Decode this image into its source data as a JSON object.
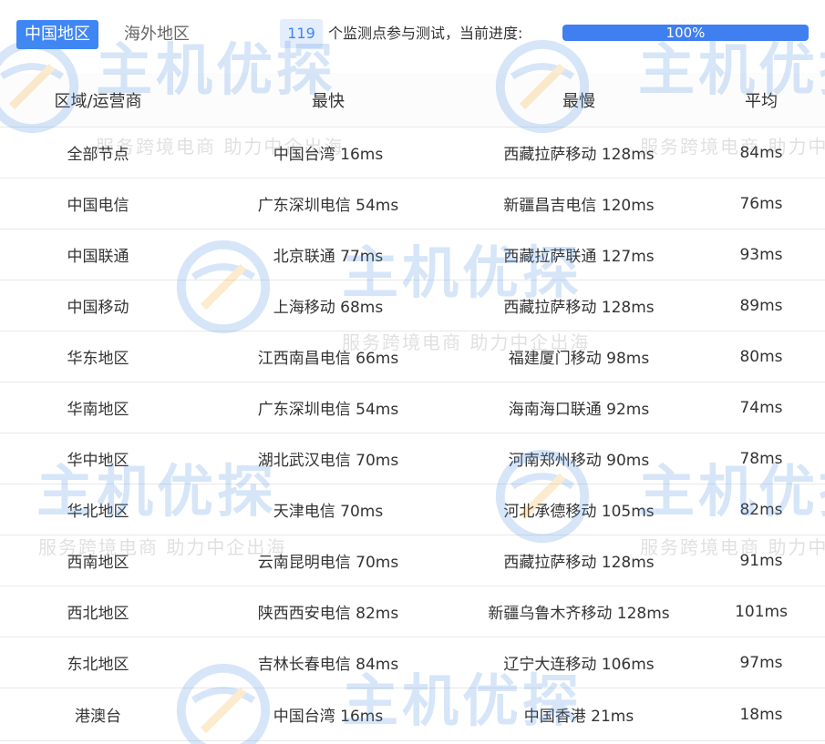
{
  "tabs": {
    "active_label": "中国地区",
    "inactive_label": "海外地区"
  },
  "monitor": {
    "count": "119",
    "text": "个监测点参与测试，当前进度:",
    "progress_percent": 100,
    "progress_label": "100%"
  },
  "table": {
    "headers": {
      "region": "区域/运营商",
      "fastest": "最快",
      "slowest": "最慢",
      "average": "平均"
    },
    "rows": [
      {
        "region": "全部节点",
        "fastest": "中国台湾 16ms",
        "slowest": "西藏拉萨移动 128ms",
        "average": "84ms"
      },
      {
        "region": "中国电信",
        "fastest": "广东深圳电信 54ms",
        "slowest": "新疆昌吉电信 120ms",
        "average": "76ms"
      },
      {
        "region": "中国联通",
        "fastest": "北京联通 77ms",
        "slowest": "西藏拉萨联通 127ms",
        "average": "93ms"
      },
      {
        "region": "中国移动",
        "fastest": "上海移动 68ms",
        "slowest": "西藏拉萨移动 128ms",
        "average": "89ms"
      },
      {
        "region": "华东地区",
        "fastest": "江西南昌电信 66ms",
        "slowest": "福建厦门移动 98ms",
        "average": "80ms"
      },
      {
        "region": "华南地区",
        "fastest": "广东深圳电信 54ms",
        "slowest": "海南海口联通 92ms",
        "average": "74ms"
      },
      {
        "region": "华中地区",
        "fastest": "湖北武汉电信 70ms",
        "slowest": "河南郑州移动 90ms",
        "average": "78ms"
      },
      {
        "region": "华北地区",
        "fastest": "天津电信 70ms",
        "slowest": "河北承德移动 105ms",
        "average": "82ms"
      },
      {
        "region": "西南地区",
        "fastest": "云南昆明电信 70ms",
        "slowest": "西藏拉萨移动 128ms",
        "average": "91ms"
      },
      {
        "region": "西北地区",
        "fastest": "陕西西安电信 82ms",
        "slowest": "新疆乌鲁木齐移动 128ms",
        "average": "101ms"
      },
      {
        "region": "东北地区",
        "fastest": "吉林长春电信 84ms",
        "slowest": "辽宁大连移动 106ms",
        "average": "97ms"
      },
      {
        "region": "港澳台",
        "fastest": "中国台湾 16ms",
        "slowest": "中国香港 21ms",
        "average": "18ms"
      }
    ]
  },
  "watermark": {
    "brand": "主机优探",
    "slogan": "服务跨境电商 助力中企出海"
  },
  "colors": {
    "accent": "#3f86f5",
    "progress_fill": "#3f7ff0",
    "badge_bg": "#e3edfc",
    "row_divider": "#e8e8e8"
  }
}
